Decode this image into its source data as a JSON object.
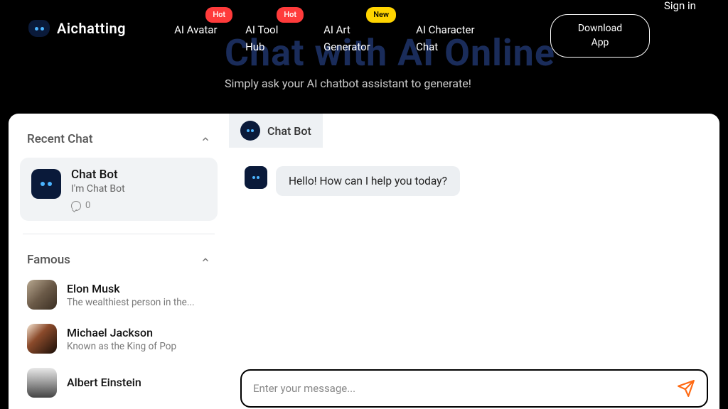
{
  "brand": {
    "name": "Aichatting"
  },
  "nav": {
    "items": [
      {
        "label": "AI Avatar",
        "badge": "Hot",
        "badge_kind": "hot"
      },
      {
        "label": "AI Tool Hub",
        "badge": "Hot",
        "badge_kind": "hot"
      },
      {
        "label": "AI Art Generator",
        "badge": "New",
        "badge_kind": "new"
      },
      {
        "label": "AI Character Chat"
      }
    ],
    "download_label": "Download App",
    "signin_label": "Sign in"
  },
  "hero": {
    "title": "Chat with AI Online",
    "subtitle": "Simply ask your AI chatbot assistant to generate!"
  },
  "sidebar": {
    "recent": {
      "title": "Recent Chat",
      "item": {
        "name": "Chat Bot",
        "desc": "I'm Chat Bot",
        "count": "0"
      }
    },
    "famous": {
      "title": "Famous",
      "items": [
        {
          "name": "Elon Musk",
          "desc": "The wealthiest person in the..."
        },
        {
          "name": "Michael Jackson",
          "desc": "Known as the King of Pop"
        },
        {
          "name": "Albert Einstein",
          "desc": ""
        }
      ]
    }
  },
  "chat": {
    "tab_label": "Chat Bot",
    "first_message": "Hello! How can I help you today?",
    "input_placeholder": "Enter your message...",
    "colors": {
      "accent_send": "#ff6a13",
      "badge_hot": "#ff3b3b",
      "badge_new": "#ffd400"
    }
  }
}
